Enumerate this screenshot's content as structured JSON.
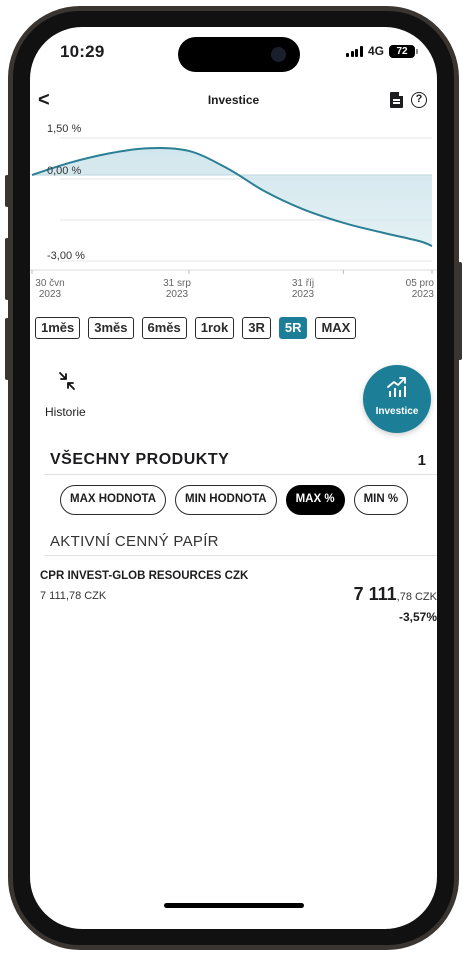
{
  "status": {
    "time": "10:29",
    "network": "4G",
    "battery": "72"
  },
  "nav": {
    "back_label": "<",
    "title": "Investice",
    "doc_icon": "document-icon",
    "help_icon": "help-circle-icon",
    "help_label": "?"
  },
  "chart_data": {
    "type": "area",
    "title": "",
    "xlabel": "",
    "ylabel": "",
    "y_ticks": [
      "1,50 %",
      "0,00 %",
      "-3,00 %"
    ],
    "x_ticks": [
      {
        "day": "30 čvn",
        "year": "2023"
      },
      {
        "day": "31 srp",
        "year": "2023"
      },
      {
        "day": "31 říj",
        "year": "2023"
      },
      {
        "day": "05 pro",
        "year": "2023"
      }
    ],
    "ylim": [
      -3.0,
      1.5
    ],
    "x": [
      "2023-06-30",
      "2023-07-15",
      "2023-07-31",
      "2023-08-15",
      "2023-08-31",
      "2023-09-15",
      "2023-09-30",
      "2023-10-15",
      "2023-10-31",
      "2023-11-15",
      "2023-11-30",
      "2023-12-05"
    ],
    "series": [
      {
        "values": [
          0.0,
          0.45,
          0.8,
          0.98,
          0.88,
          0.25,
          -0.6,
          -1.25,
          -1.75,
          -2.1,
          -2.42,
          -2.6
        ]
      }
    ],
    "colors": {
      "line": "#2a7f95",
      "fill": "#cfe5ec"
    },
    "grid": true
  },
  "ranges": [
    {
      "label": "1měs",
      "active": false
    },
    {
      "label": "3měs",
      "active": false
    },
    {
      "label": "6měs",
      "active": false
    },
    {
      "label": "1rok",
      "active": false
    },
    {
      "label": "3R",
      "active": false
    },
    {
      "label": "5R",
      "active": true
    },
    {
      "label": "MAX",
      "active": false
    }
  ],
  "actions": {
    "history_label": "Historie",
    "history_icon": "collapse-arrows-icon",
    "invest_label": "Investice",
    "invest_icon": "growth-chart-icon"
  },
  "products": {
    "title": "VŠECHNY PRODUKTY",
    "count": "1",
    "filters": [
      {
        "label": "MAX HODNOTA",
        "active": false
      },
      {
        "label": "MIN HODNOTA",
        "active": false
      },
      {
        "label": "MAX %",
        "active": true
      },
      {
        "label": "MIN %",
        "active": false
      }
    ],
    "subsection": "AKTIVNÍ CENNÝ PAPÍR",
    "items": [
      {
        "name": "CPR INVEST-GLOB RESOURCES CZK",
        "subvalue": "7 111,78 CZK",
        "value_main": "7 111",
        "value_rest": ",78 CZK",
        "change": "-3,57%"
      }
    ]
  },
  "accent": "#1d7f97"
}
